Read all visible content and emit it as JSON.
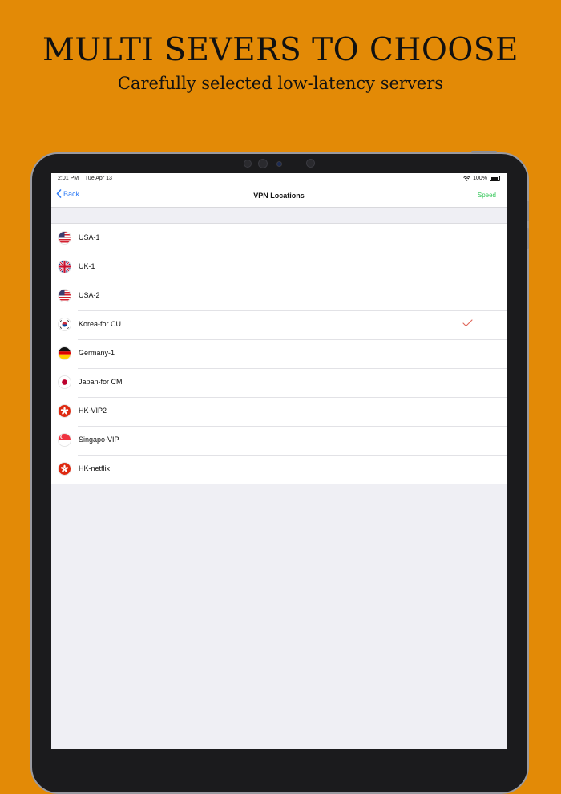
{
  "headline": "MULTI SEVERS TO CHOOSE",
  "subline": "Carefully selected low-latency servers",
  "status": {
    "time": "2:01 PM",
    "date": "Tue Apr 13",
    "battery": "100%"
  },
  "nav": {
    "back": "Back",
    "title": "VPN Locations",
    "speed": "Speed"
  },
  "servers": [
    {
      "label": "USA-1",
      "flag": "us-flag-icon"
    },
    {
      "label": "UK-1",
      "flag": "uk-flag-icon"
    },
    {
      "label": "USA-2",
      "flag": "us-flag-icon"
    },
    {
      "label": "Korea-for CU",
      "flag": "korea-flag-icon",
      "selected": true
    },
    {
      "label": "Germany-1",
      "flag": "germany-flag-icon"
    },
    {
      "label": "Japan-for CM",
      "flag": "japan-flag-icon"
    },
    {
      "label": "HK-VIP2",
      "flag": "hongkong-flag-icon"
    },
    {
      "label": "Singapo-VIP",
      "flag": "singapore-flag-icon"
    },
    {
      "label": "HK-netflix",
      "flag": "hongkong-flag-icon"
    }
  ],
  "colors": {
    "background": "#E38A06",
    "accent": "#2F7CF6",
    "speed": "#34C759",
    "check": "#E0675B"
  }
}
